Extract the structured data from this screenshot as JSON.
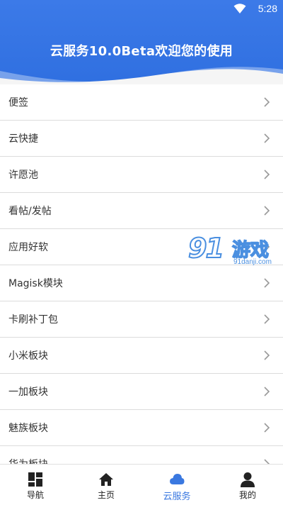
{
  "status": {
    "time": "5:28"
  },
  "header": {
    "title": "云服务10.0Beta欢迎您的使用"
  },
  "list": {
    "items": [
      {
        "label": "便签"
      },
      {
        "label": "云快捷"
      },
      {
        "label": "许愿池"
      },
      {
        "label": "看帖/发帖"
      },
      {
        "label": "应用好软"
      },
      {
        "label": "Magisk模块"
      },
      {
        "label": "卡刷补丁包"
      },
      {
        "label": "小米板块"
      },
      {
        "label": "一加板块"
      },
      {
        "label": "魅族板块"
      },
      {
        "label": "华为板块"
      }
    ]
  },
  "watermark": {
    "number": "91",
    "text": "游戏",
    "url": "91danji.com"
  },
  "tabbar": {
    "tabs": [
      {
        "label": "导航",
        "icon": "dashboard-icon"
      },
      {
        "label": "主页",
        "icon": "home-icon"
      },
      {
        "label": "云服务",
        "icon": "cloud-icon",
        "active": true
      },
      {
        "label": "我的",
        "icon": "person-icon"
      }
    ]
  },
  "colors": {
    "primary": "#3a78e0",
    "text": "#333333",
    "divider": "#dcdcdc"
  }
}
